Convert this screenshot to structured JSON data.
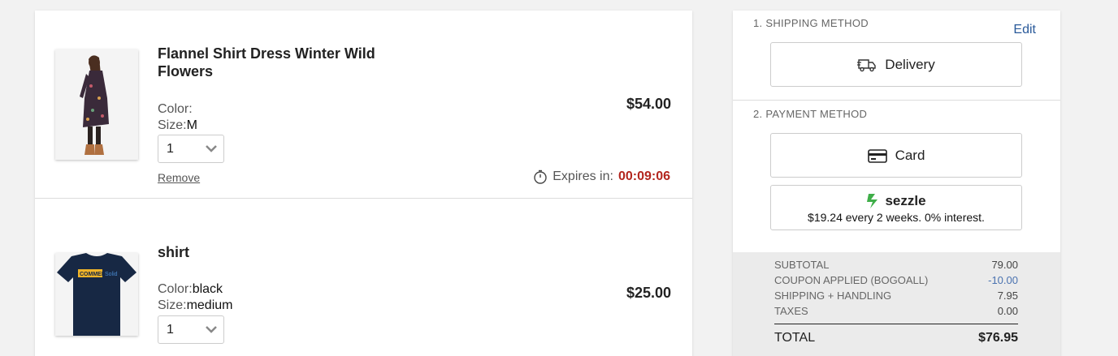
{
  "cart": {
    "items": [
      {
        "name": "Flannel Shirt Dress Winter Wild Flowers",
        "color_label": "Color:",
        "color_value": "",
        "size_label": "Size:",
        "size_value": "M",
        "quantity": "1",
        "remove_label": "Remove",
        "price": "$54.00",
        "expires_label": "Expires in:",
        "expires_time": "00:09:06",
        "image": "dress-photo"
      },
      {
        "name": "shirt",
        "color_label": "Color:",
        "color_value": "black",
        "size_label": "Size:",
        "size_value": "medium",
        "quantity": "1",
        "price": "$25.00",
        "image": "tshirt-photo",
        "shirt_print": "COMMERCE",
        "shirt_print_2": "Solid"
      }
    ]
  },
  "checkout": {
    "shipping_title": "1. SHIPPING METHOD",
    "edit_label": "Edit",
    "delivery_label": "Delivery",
    "payment_title": "2. PAYMENT METHOD",
    "card_label": "Card",
    "sezzle_brand": "sezzle",
    "sezzle_terms": "$19.24 every 2 weeks. 0% interest."
  },
  "summary": {
    "subtotal_label": "SUBTOTAL",
    "subtotal_value": "79.00",
    "coupon_label": "COUPON APPLIED (BOGOALL)",
    "coupon_value": "-10.00",
    "shipping_label": "SHIPPING + HANDLING",
    "shipping_value": "7.95",
    "taxes_label": "TAXES",
    "taxes_value": "0.00",
    "total_label": "TOTAL",
    "total_value": "$76.95"
  },
  "colors": {
    "accent_link": "#2a5a9a",
    "timer_red": "#b3261e",
    "discount_blue": "#4a72b0",
    "sezzle_green": "#3fae49"
  }
}
